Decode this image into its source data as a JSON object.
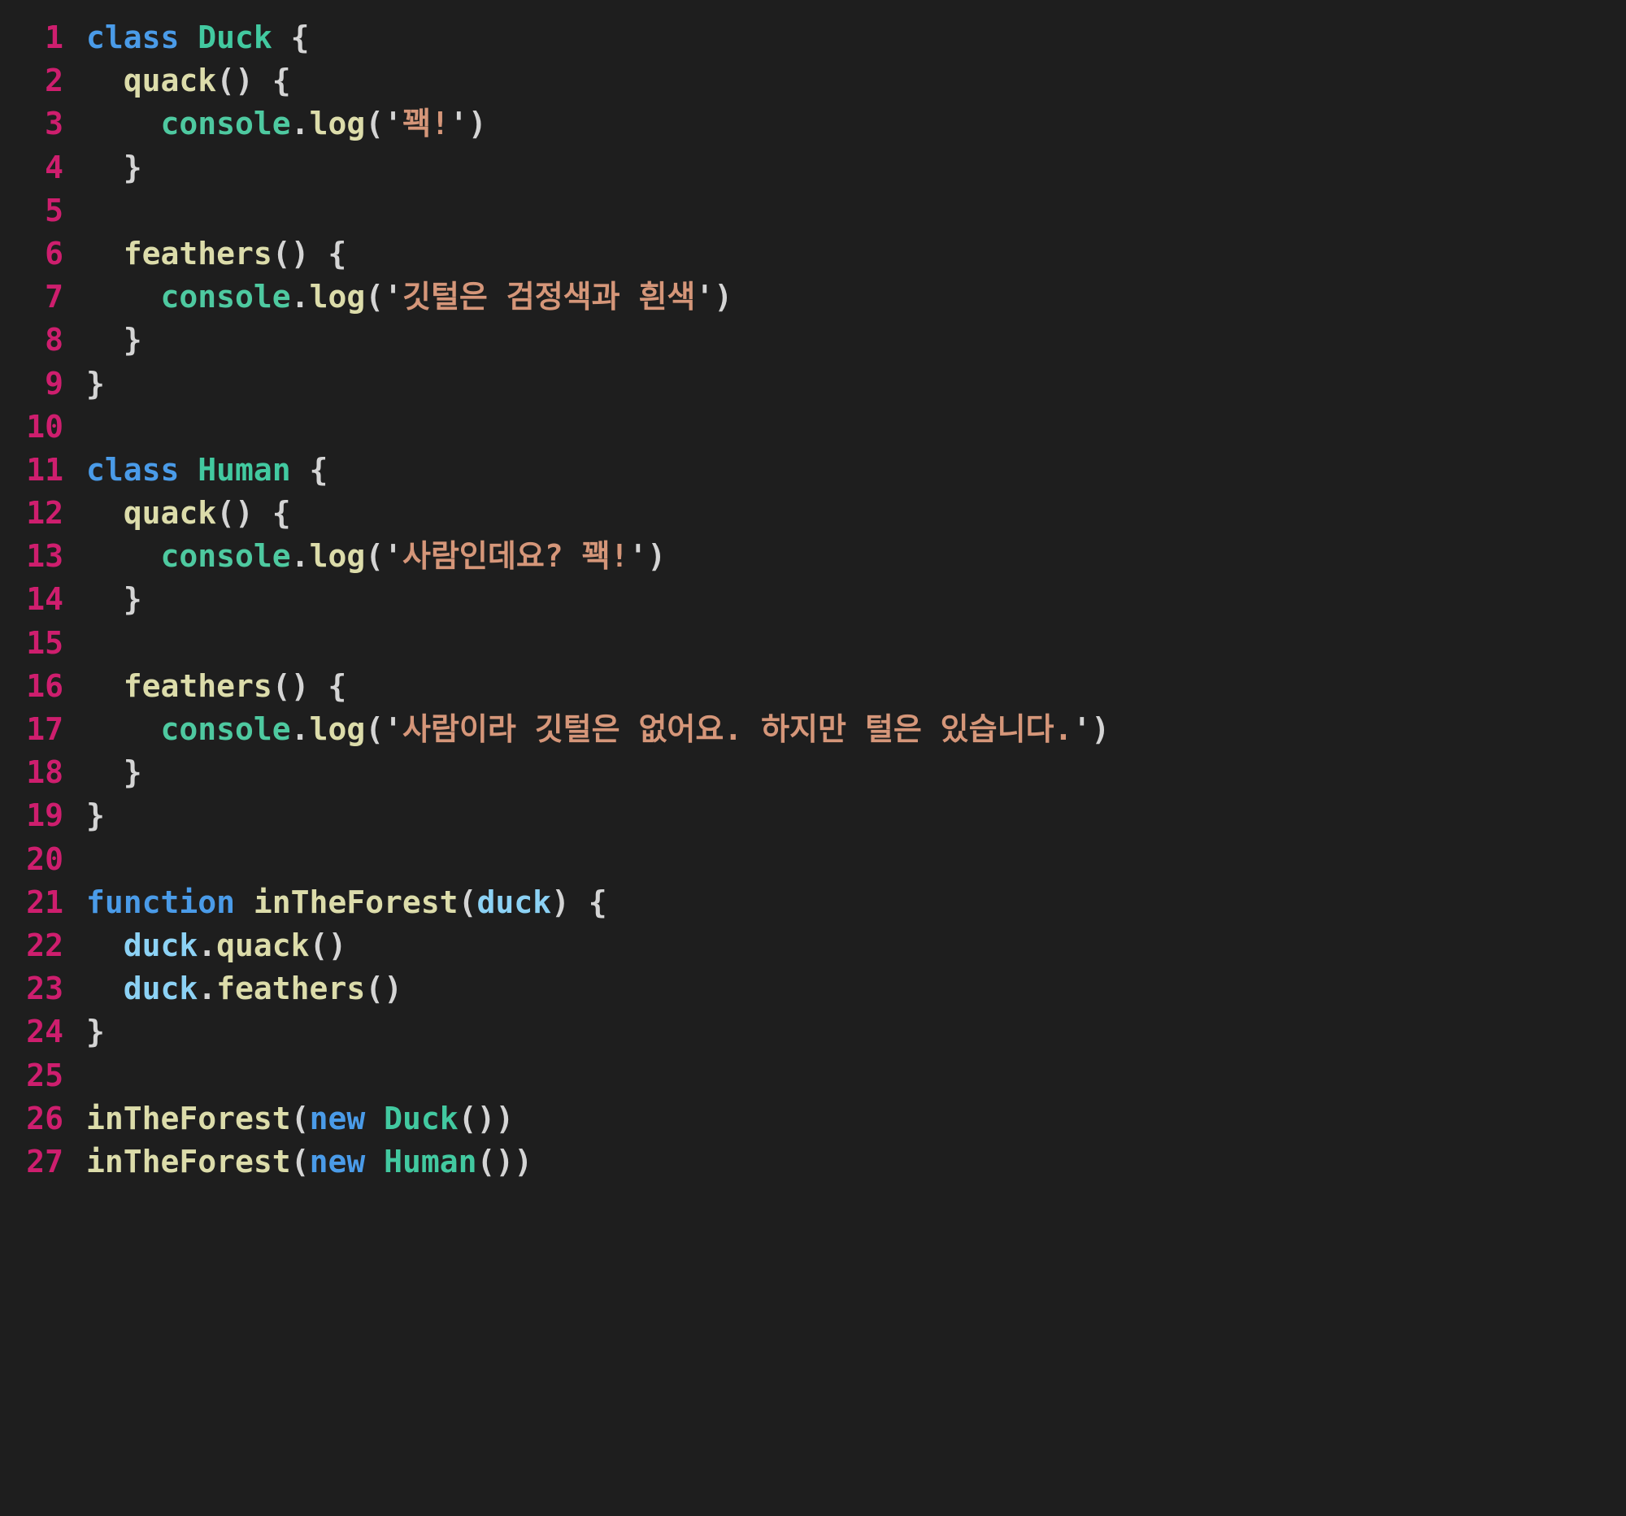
{
  "editor": {
    "language": "javascript",
    "background_color": "#1e1e1e",
    "line_number_color": "#ce1e6e",
    "first_line": 1,
    "last_line": 27,
    "total_lines": 27,
    "colors": {
      "keyword": "#4a9be8",
      "class_name": "#42c9a0",
      "function": "#dcdcaa",
      "object": "#4ec9a0",
      "variable": "#8cd2f5",
      "string": "#d59679",
      "punctuation": "#d4d4d4"
    }
  },
  "lines": [
    {
      "number": "1",
      "tokens": [
        {
          "text": "class ",
          "type": "keyword"
        },
        {
          "text": "Duck",
          "type": "class"
        },
        {
          "text": " {",
          "type": "punct"
        }
      ]
    },
    {
      "number": "2",
      "tokens": [
        {
          "text": "  ",
          "type": "plain"
        },
        {
          "text": "quack",
          "type": "method"
        },
        {
          "text": "() {",
          "type": "punct"
        }
      ]
    },
    {
      "number": "3",
      "tokens": [
        {
          "text": "    ",
          "type": "plain"
        },
        {
          "text": "console",
          "type": "object"
        },
        {
          "text": ".",
          "type": "punct"
        },
        {
          "text": "log",
          "type": "method"
        },
        {
          "text": "(",
          "type": "punct"
        },
        {
          "text": "'",
          "type": "quote"
        },
        {
          "text": "꽥!",
          "type": "string"
        },
        {
          "text": "'",
          "type": "quote"
        },
        {
          "text": ")",
          "type": "punct"
        }
      ]
    },
    {
      "number": "4",
      "tokens": [
        {
          "text": "  }",
          "type": "punct"
        }
      ]
    },
    {
      "number": "5",
      "tokens": []
    },
    {
      "number": "6",
      "tokens": [
        {
          "text": "  ",
          "type": "plain"
        },
        {
          "text": "feathers",
          "type": "method"
        },
        {
          "text": "() {",
          "type": "punct"
        }
      ]
    },
    {
      "number": "7",
      "tokens": [
        {
          "text": "    ",
          "type": "plain"
        },
        {
          "text": "console",
          "type": "object"
        },
        {
          "text": ".",
          "type": "punct"
        },
        {
          "text": "log",
          "type": "method"
        },
        {
          "text": "(",
          "type": "punct"
        },
        {
          "text": "'",
          "type": "quote"
        },
        {
          "text": "깃털은 검정색과 흰색",
          "type": "string"
        },
        {
          "text": "'",
          "type": "quote"
        },
        {
          "text": ")",
          "type": "punct"
        }
      ]
    },
    {
      "number": "8",
      "tokens": [
        {
          "text": "  }",
          "type": "punct"
        }
      ]
    },
    {
      "number": "9",
      "tokens": [
        {
          "text": "}",
          "type": "punct"
        }
      ]
    },
    {
      "number": "10",
      "tokens": []
    },
    {
      "number": "11",
      "tokens": [
        {
          "text": "class ",
          "type": "keyword"
        },
        {
          "text": "Human",
          "type": "class"
        },
        {
          "text": " {",
          "type": "punct"
        }
      ]
    },
    {
      "number": "12",
      "tokens": [
        {
          "text": "  ",
          "type": "plain"
        },
        {
          "text": "quack",
          "type": "method"
        },
        {
          "text": "() {",
          "type": "punct"
        }
      ]
    },
    {
      "number": "13",
      "tokens": [
        {
          "text": "    ",
          "type": "plain"
        },
        {
          "text": "console",
          "type": "object"
        },
        {
          "text": ".",
          "type": "punct"
        },
        {
          "text": "log",
          "type": "method"
        },
        {
          "text": "(",
          "type": "punct"
        },
        {
          "text": "'",
          "type": "quote"
        },
        {
          "text": "사람인데요? 꽥!",
          "type": "string"
        },
        {
          "text": "'",
          "type": "quote"
        },
        {
          "text": ")",
          "type": "punct"
        }
      ]
    },
    {
      "number": "14",
      "tokens": [
        {
          "text": "  }",
          "type": "punct"
        }
      ]
    },
    {
      "number": "15",
      "tokens": []
    },
    {
      "number": "16",
      "tokens": [
        {
          "text": "  ",
          "type": "plain"
        },
        {
          "text": "feathers",
          "type": "method"
        },
        {
          "text": "() {",
          "type": "punct"
        }
      ]
    },
    {
      "number": "17",
      "tokens": [
        {
          "text": "    ",
          "type": "plain"
        },
        {
          "text": "console",
          "type": "object"
        },
        {
          "text": ".",
          "type": "punct"
        },
        {
          "text": "log",
          "type": "method"
        },
        {
          "text": "(",
          "type": "punct"
        },
        {
          "text": "'",
          "type": "quote"
        },
        {
          "text": "사람이라 깃털은 없어요. 하지만 털은 있습니다.",
          "type": "string"
        },
        {
          "text": "'",
          "type": "quote"
        },
        {
          "text": ")",
          "type": "punct"
        }
      ]
    },
    {
      "number": "18",
      "tokens": [
        {
          "text": "  }",
          "type": "punct"
        }
      ]
    },
    {
      "number": "19",
      "tokens": [
        {
          "text": "}",
          "type": "punct"
        }
      ]
    },
    {
      "number": "20",
      "tokens": []
    },
    {
      "number": "21",
      "tokens": [
        {
          "text": "function ",
          "type": "keyword"
        },
        {
          "text": "inTheForest",
          "type": "func"
        },
        {
          "text": "(",
          "type": "punct"
        },
        {
          "text": "duck",
          "type": "param"
        },
        {
          "text": ") {",
          "type": "punct"
        }
      ]
    },
    {
      "number": "22",
      "tokens": [
        {
          "text": "  ",
          "type": "plain"
        },
        {
          "text": "duck",
          "type": "var"
        },
        {
          "text": ".",
          "type": "punct"
        },
        {
          "text": "quack",
          "type": "method"
        },
        {
          "text": "()",
          "type": "punct"
        }
      ]
    },
    {
      "number": "23",
      "tokens": [
        {
          "text": "  ",
          "type": "plain"
        },
        {
          "text": "duck",
          "type": "var"
        },
        {
          "text": ".",
          "type": "punct"
        },
        {
          "text": "feathers",
          "type": "method"
        },
        {
          "text": "()",
          "type": "punct"
        }
      ]
    },
    {
      "number": "24",
      "tokens": [
        {
          "text": "}",
          "type": "punct"
        }
      ]
    },
    {
      "number": "25",
      "tokens": []
    },
    {
      "number": "26",
      "tokens": [
        {
          "text": "inTheForest",
          "type": "func"
        },
        {
          "text": "(",
          "type": "punct"
        },
        {
          "text": "new ",
          "type": "keyword"
        },
        {
          "text": "Duck",
          "type": "class"
        },
        {
          "text": "())",
          "type": "punct"
        }
      ]
    },
    {
      "number": "27",
      "tokens": [
        {
          "text": "inTheForest",
          "type": "func"
        },
        {
          "text": "(",
          "type": "punct"
        },
        {
          "text": "new ",
          "type": "keyword"
        },
        {
          "text": "Human",
          "type": "class"
        },
        {
          "text": "())",
          "type": "punct"
        }
      ]
    }
  ]
}
